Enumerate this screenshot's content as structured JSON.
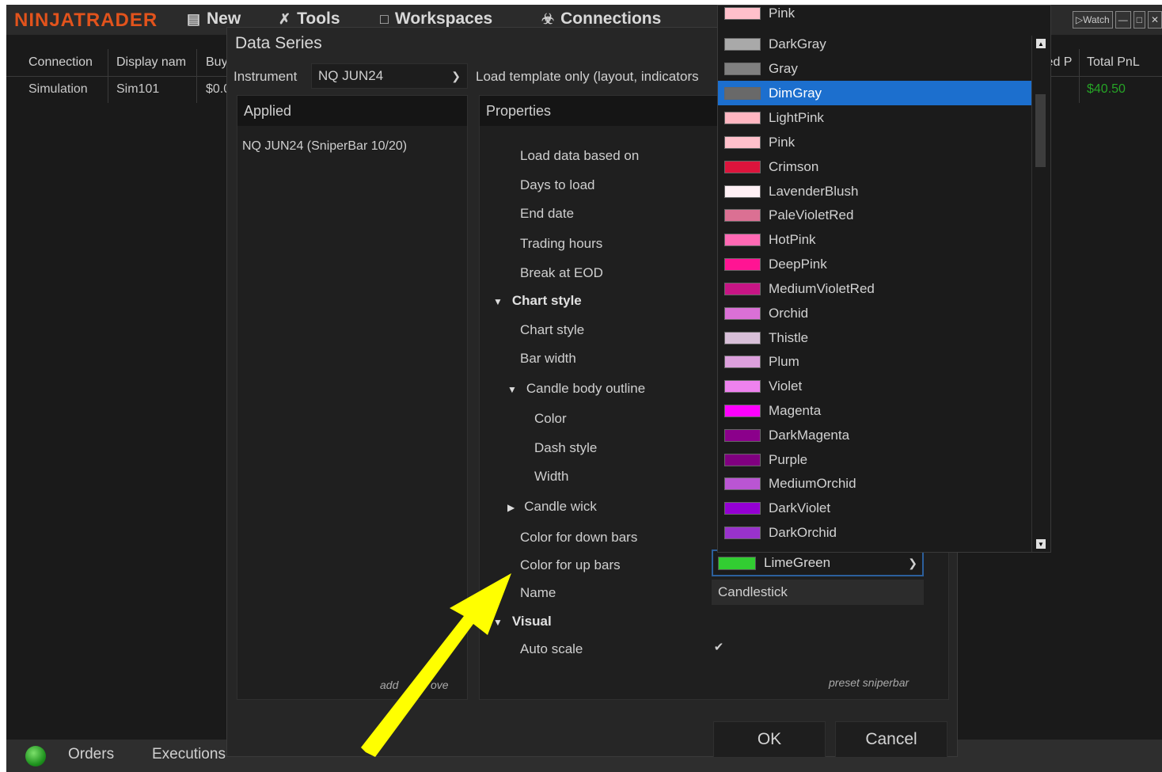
{
  "app": {
    "logo": "NINJATRADER",
    "menu": [
      {
        "label": "New",
        "icon": "new-window-icon"
      },
      {
        "label": "Tools",
        "icon": "tools-icon"
      },
      {
        "label": "Workspaces",
        "icon": "workspaces-icon"
      },
      {
        "label": "Connections",
        "icon": "plug-icon"
      }
    ],
    "window_buttons": [
      "Watch",
      "minimize",
      "maximize",
      "close"
    ]
  },
  "background_grid": {
    "headers": [
      "Connection",
      "Display nam",
      "Buy",
      "ized P",
      "Total PnL"
    ],
    "row": [
      "Simulation",
      "Sim101",
      "$0.0",
      "$40.50"
    ],
    "pnl_color": "#26a326"
  },
  "bottom_tabs": [
    "Orders",
    "Executions"
  ],
  "dialog": {
    "title": "Data Series",
    "instrument_label": "Instrument",
    "instrument_value": "NQ JUN24",
    "template_label": "Load template only (layout, indicators",
    "applied_header": "Applied",
    "applied_items": [
      "NQ JUN24 (SniperBar 10/20)"
    ],
    "add_label": "add",
    "remove_label": "ove",
    "properties_header": "Properties",
    "properties": {
      "load_data_based_on": "Load data based on",
      "days_to_load": "Days to load",
      "end_date": "End date",
      "trading_hours": "Trading hours",
      "break_at_eod": "Break at EOD",
      "chart_style_group": "Chart style",
      "chart_style": "Chart style",
      "bar_width": "Bar width",
      "candle_body_outline": "Candle body outline",
      "color": "Color",
      "dash_style": "Dash style",
      "width": "Width",
      "candle_wick": "Candle wick",
      "color_down_bars": "Color for down bars",
      "color_up_bars": "Color for up bars",
      "name": "Name",
      "visual_group": "Visual",
      "auto_scale": "Auto scale"
    },
    "up_bars_value": "LimeGreen",
    "up_bars_color": "#32cd32",
    "name_value": "Candlestick",
    "auto_scale_checked": true,
    "preset_label": "preset sniperbar",
    "ok_label": "OK",
    "cancel_label": "Cancel"
  },
  "color_dropdown": {
    "selected": "DimGray",
    "items": [
      {
        "name": "Pink",
        "color": "#ffc0cb"
      },
      {
        "name": "DarkGray",
        "color": "#a9a9a9"
      },
      {
        "name": "Gray",
        "color": "#808080"
      },
      {
        "name": "DimGray",
        "color": "#696969"
      },
      {
        "name": "LightPink",
        "color": "#ffb6c1"
      },
      {
        "name": "Pink",
        "color": "#ffc0cb"
      },
      {
        "name": "Crimson",
        "color": "#dc143c"
      },
      {
        "name": "LavenderBlush",
        "color": "#fff0f5"
      },
      {
        "name": "PaleVioletRed",
        "color": "#db7093"
      },
      {
        "name": "HotPink",
        "color": "#ff69b4"
      },
      {
        "name": "DeepPink",
        "color": "#ff1493"
      },
      {
        "name": "MediumVioletRed",
        "color": "#c71585"
      },
      {
        "name": "Orchid",
        "color": "#da70d6"
      },
      {
        "name": "Thistle",
        "color": "#d8bfd8"
      },
      {
        "name": "Plum",
        "color": "#dda0dd"
      },
      {
        "name": "Violet",
        "color": "#ee82ee"
      },
      {
        "name": "Magenta",
        "color": "#ff00ff"
      },
      {
        "name": "DarkMagenta",
        "color": "#8b008b"
      },
      {
        "name": "Purple",
        "color": "#800080"
      },
      {
        "name": "MediumOrchid",
        "color": "#ba55d3"
      },
      {
        "name": "DarkViolet",
        "color": "#9400d3"
      },
      {
        "name": "DarkOrchid",
        "color": "#9932cc"
      }
    ]
  },
  "annotation_arrow_color": "#ffff00"
}
